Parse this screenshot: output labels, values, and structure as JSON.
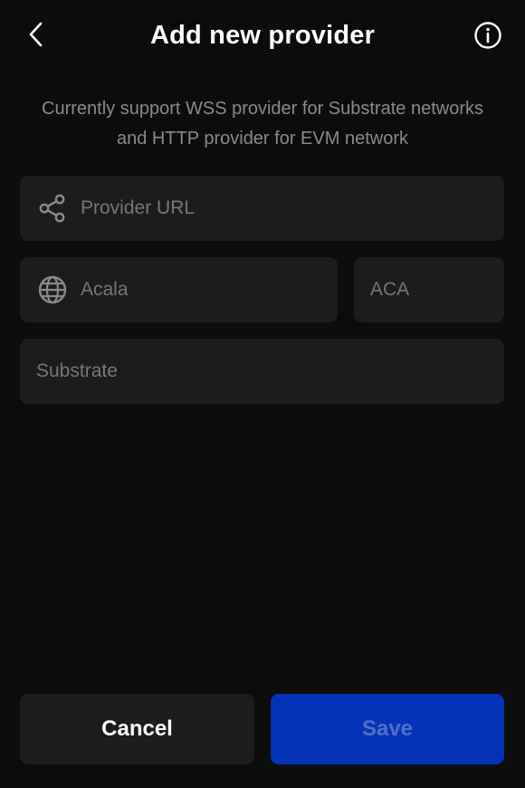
{
  "header": {
    "title": "Add new provider",
    "back_icon": "chevron-left-icon",
    "info_icon": "info-circle-icon"
  },
  "description": "Currently support WSS provider for Substrate networks and HTTP provider for EVM network",
  "form": {
    "provider_url": {
      "placeholder": "Provider URL",
      "value": "",
      "icon": "share-nodes-icon"
    },
    "network_name": {
      "placeholder": "Acala",
      "value": "",
      "icon": "globe-icon"
    },
    "symbol": {
      "placeholder": "ACA",
      "value": ""
    },
    "network_type": {
      "value": "Substrate"
    }
  },
  "buttons": {
    "cancel_label": "Cancel",
    "save_label": "Save"
  },
  "colors": {
    "background": "#0c0c0c",
    "field_bg": "#1c1c1c",
    "primary": "#0533b8",
    "muted_text": "#8a8a8a"
  }
}
